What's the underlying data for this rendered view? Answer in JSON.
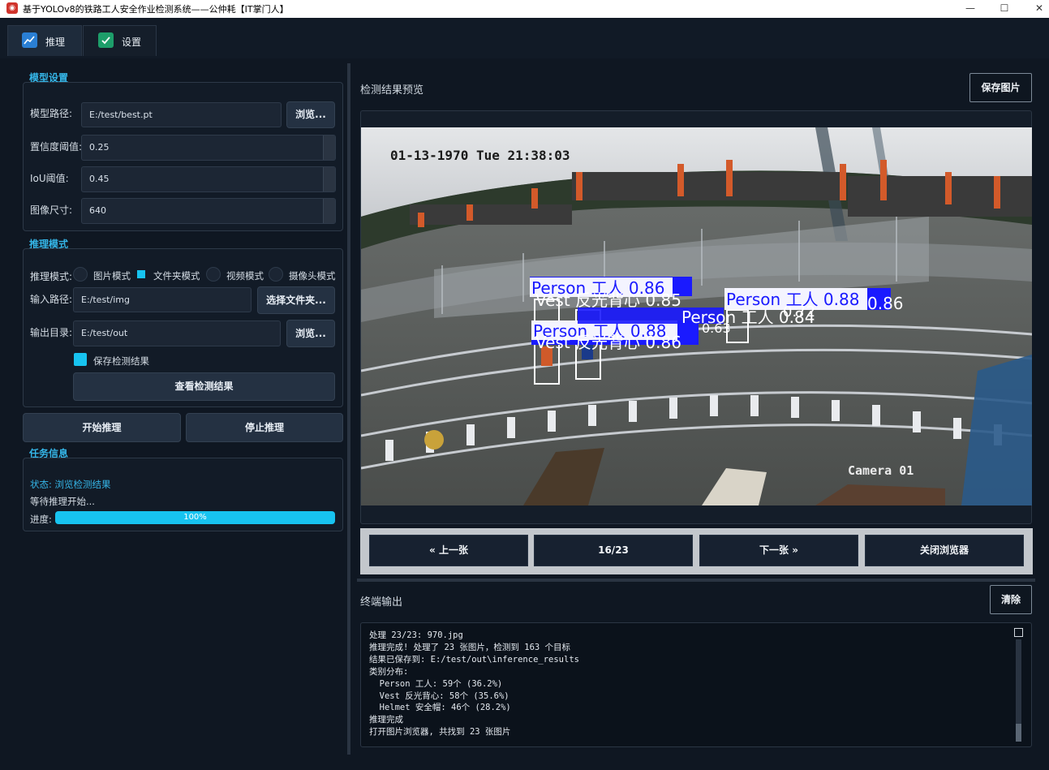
{
  "window": {
    "title": "基于YOLOv8的铁路工人安全作业检测系统——公仲耗【IT掌门人】",
    "minimize": "—",
    "maximize": "☐",
    "close": "✕"
  },
  "tabs": [
    {
      "label": "推理",
      "icon": "chart-line-icon"
    },
    {
      "label": "设置",
      "icon": "check-shield-icon"
    }
  ],
  "model_settings": {
    "section_title": "模型设置",
    "model_path_label": "模型路径:",
    "model_path_value": "E:/test/best.pt",
    "browse_label": "浏览...",
    "confidence_label": "置信度阈值:",
    "confidence_value": "0.25",
    "iou_label": "IoU阈值:",
    "iou_value": "0.45",
    "image_size_label": "图像尺寸:",
    "image_size_value": "640"
  },
  "inference_mode": {
    "section_title": "推理模式",
    "mode_label": "推理模式:",
    "modes": [
      "图片模式",
      "文件夹模式",
      "视频模式",
      "摄像头模式"
    ],
    "selected_mode": "文件夹模式",
    "input_path_label": "输入路径:",
    "input_path_value": "E:/test/img",
    "choose_folder_label": "选择文件夹...",
    "output_dir_label": "输出目录:",
    "output_dir_value": "E:/test/out",
    "browse_label": "浏览...",
    "save_results_label": "保存检测结果",
    "save_results_checked": true,
    "view_results_label": "查看检测结果"
  },
  "actions": {
    "start_label": "开始推理",
    "stop_label": "停止推理"
  },
  "task_info": {
    "section_title": "任务信息",
    "status_text": "状态: 浏览检测结果",
    "waiting_text": "等待推理开始...",
    "progress_label": "进度:",
    "progress_value": 1.0,
    "progress_text": "100%"
  },
  "preview": {
    "title": "检测结果预览",
    "save_label": "保存图片",
    "timestamp": "01-13-1970 Tue 21:38:03",
    "camera_label": "Camera 01",
    "detections": [
      "Person 工人 0.86",
      "Person 工人 0.88",
      "Person 工人 0.88",
      "Person 工人 0.84",
      "Vest 反光背心 0.85",
      "Vest 反光背心 0.86",
      "0.86",
      "0.72",
      "0.63"
    ]
  },
  "navigator": {
    "prev_label": "« 上一张",
    "counter": "16/23",
    "next_label": "下一张 »",
    "close_label": "关闭浏览器"
  },
  "terminal": {
    "title": "终端输出",
    "clear_label": "清除",
    "lines": [
      "处理 23/23: 970.jpg",
      "推理完成! 处理了 23 张图片，检测到 163 个目标",
      "结果已保存到: E:/test/out\\inference_results",
      "类别分布:",
      "  Person 工人: 59个 (36.2%)",
      "  Vest 反光背心: 58个 (35.6%)",
      "  Helmet 安全帽: 46个 (28.2%)",
      "推理完成",
      "打开图片浏览器, 共找到 23 张图片"
    ]
  },
  "colors": {
    "accent": "#17c3f0",
    "section_title": "#35b6e8",
    "background": "#0f1722",
    "detection_box": "#1a1aff"
  }
}
